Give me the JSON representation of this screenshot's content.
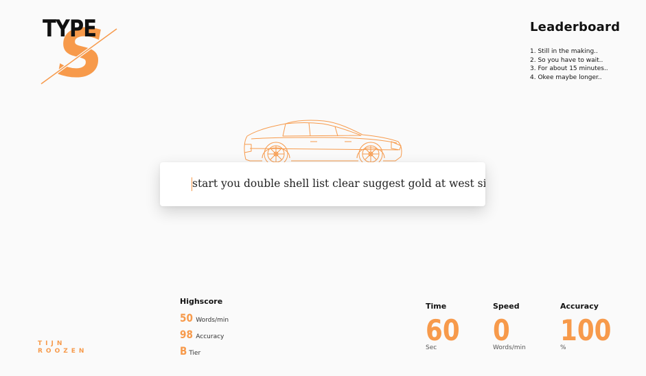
{
  "brand": {
    "logo_word": "TYPE",
    "logo_letter": "S",
    "accent": "#f79a4b"
  },
  "leaderboard": {
    "title": "Leaderboard",
    "entries": [
      "1. Still in the making..",
      "2. So you have to wait..",
      "3. For about 15 minutes..",
      "4. Okee maybe longer.."
    ]
  },
  "typing": {
    "words": "start you double shell list clear suggest gold at west six m"
  },
  "highscore": {
    "title": "Highscore",
    "words_per_min": {
      "value": "50",
      "label": "Words/min"
    },
    "accuracy": {
      "value": "98",
      "label": "Accuracy"
    },
    "tier": {
      "value": "B",
      "label": "Tier"
    }
  },
  "stats": {
    "time": {
      "title": "Time",
      "value": "60",
      "unit": "Sec"
    },
    "speed": {
      "title": "Speed",
      "value": "0",
      "unit": "Words/min"
    },
    "accuracy": {
      "title": "Accuracy",
      "value": "100",
      "unit": "%"
    }
  },
  "author": {
    "first": "TIJN",
    "last": "ROOZEN"
  }
}
